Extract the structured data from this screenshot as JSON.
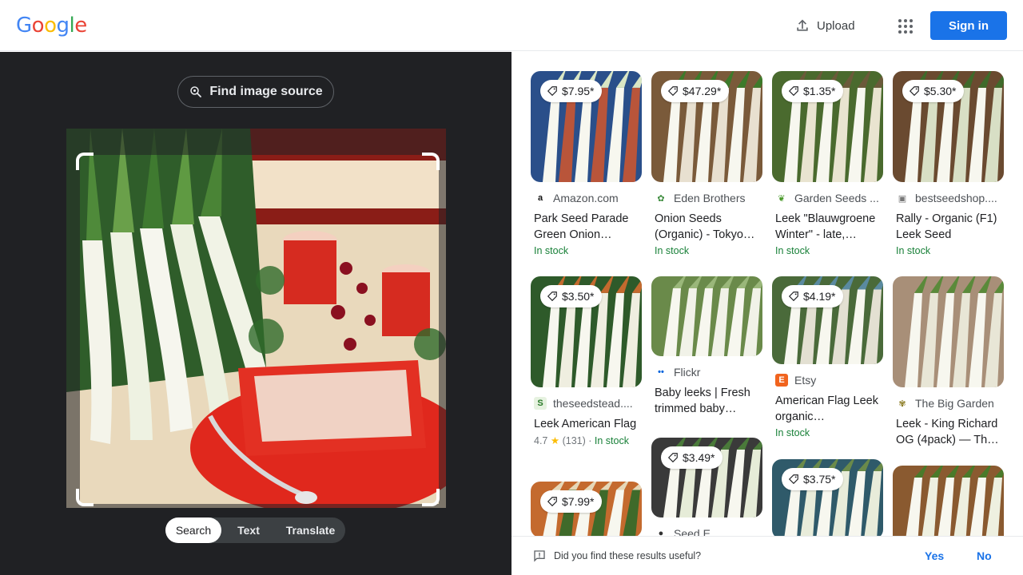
{
  "header": {
    "logo": [
      "G",
      "o",
      "o",
      "g",
      "l",
      "e"
    ],
    "logo_colors": [
      "#4285f4",
      "#ea4335",
      "#fbbc05",
      "#4285f4",
      "#34a853",
      "#ea4335"
    ],
    "upload_label": "Upload",
    "signin_label": "Sign in",
    "icons": {
      "upload": "upload-icon",
      "apps": "apps-grid-icon"
    }
  },
  "lens": {
    "find_source_label": "Find image source",
    "modes": [
      {
        "label": "Search",
        "active": true
      },
      {
        "label": "Text",
        "active": false
      },
      {
        "label": "Translate",
        "active": false
      }
    ]
  },
  "results": [
    {
      "price": "$7.95*",
      "source": "Amazon.com",
      "title": "Park Seed Parade Green Onion…",
      "stock": "In stock",
      "rating": "",
      "colors": [
        "#2a4f8a",
        "#b9553a",
        "#d9e6c4"
      ]
    },
    {
      "price": "$47.29*",
      "source": "Eden Brothers",
      "title": "Onion Seeds (Organic) - Tokyo…",
      "stock": "In stock",
      "rating": "",
      "colors": [
        "#7a5a3a",
        "#e8e0d0",
        "#3d7a2a"
      ]
    },
    {
      "price": "$1.35*",
      "source": "Garden Seeds ...",
      "title": "Leek \"Blauwgroene Winter\" - late,…",
      "stock": "In stock",
      "rating": "",
      "colors": [
        "#4a6a2e",
        "#e9e4d0",
        "#6b5a3a"
      ]
    },
    {
      "price": "$5.30*",
      "source": "bestseedshop....",
      "title": "Rally - Organic (F1) Leek Seed",
      "stock": "In stock",
      "rating": "",
      "colors": [
        "#6a4a30",
        "#d8dfc5",
        "#3f6a2a"
      ]
    },
    {
      "price": "$3.50*",
      "source": "theseedstead....",
      "title": "Leek American Flag",
      "stock": "In stock",
      "rating": "4.7",
      "reviews": "(131)",
      "colors": [
        "#2e5a2a",
        "#efeee0",
        "#c46a2e"
      ]
    },
    {
      "price": "",
      "source": "Flickr",
      "title": "Baby leeks | Fresh trimmed baby…",
      "stock": "",
      "rating": "",
      "colors": [
        "#6a8a4a",
        "#f1f2e8",
        "#9ab77a"
      ]
    },
    {
      "price": "$4.19*",
      "source": "Etsy",
      "title": "American Flag Leek organic…",
      "stock": "In stock",
      "rating": "",
      "colors": [
        "#4a6a3a",
        "#e3e0d2",
        "#5a8aa0"
      ]
    },
    {
      "price": "",
      "source": "The Big Garden",
      "title": "Leek - King Richard OG (4pack) — Th…",
      "stock": "",
      "rating": "",
      "colors": [
        "#a88f78",
        "#e8e6d6",
        "#5a8a3a"
      ]
    },
    {
      "price": "$7.99*",
      "source": "",
      "title": "",
      "stock": "",
      "rating": "",
      "colors": [
        "#c46a2e",
        "#3f6a2a",
        "#e6d8b8"
      ]
    },
    {
      "price": "$3.49*",
      "source": "Seed E...",
      "title": "",
      "stock": "",
      "rating": "",
      "colors": [
        "#3a3a3a",
        "#e6ecd8",
        "#4a7a3a"
      ]
    },
    {
      "price": "$3.75*",
      "source": "",
      "title": "",
      "stock": "",
      "rating": "",
      "colors": [
        "#2f5a6a",
        "#e8ecda",
        "#6a8a4a"
      ]
    },
    {
      "price": "",
      "source": "",
      "title": "",
      "stock": "",
      "rating": "",
      "colors": [
        "#8a5a30",
        "#eef0e0",
        "#4a7a2a"
      ]
    }
  ],
  "feedback": {
    "question": "Did you find these results useful?",
    "yes": "Yes",
    "no": "No"
  }
}
